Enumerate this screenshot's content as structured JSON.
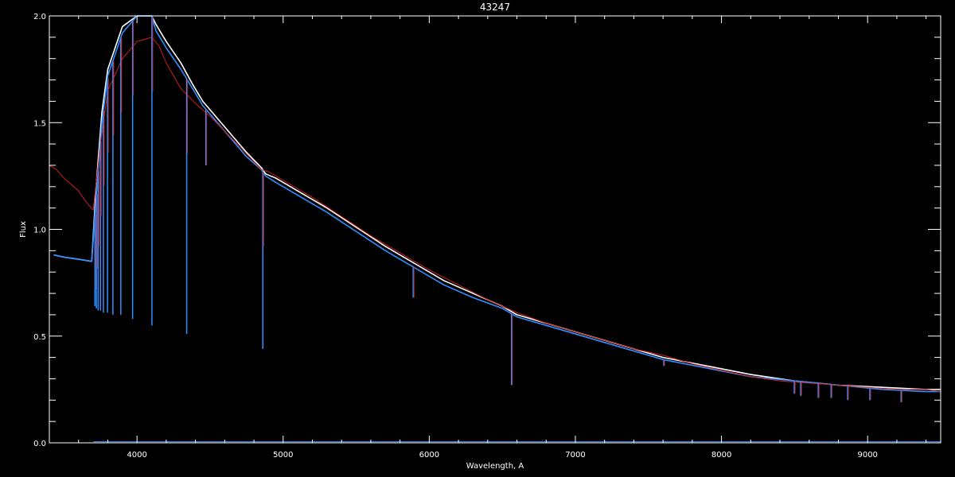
{
  "chart_data": {
    "type": "line",
    "title": "43247",
    "xlabel": "Wavelength, A",
    "ylabel": "Flux",
    "xlim": [
      3400,
      9500
    ],
    "ylim": [
      0.0,
      2.0
    ],
    "xticks": [
      4000,
      5000,
      6000,
      7000,
      8000,
      9000
    ],
    "xtick_labels": [
      "4000",
      "5000",
      "6000",
      "7000",
      "8000",
      "9000"
    ],
    "yticks": [
      0.0,
      0.5,
      1.0,
      1.5,
      2.0
    ],
    "ytick_labels": [
      "0.0",
      "0.5",
      "1.0",
      "1.5",
      "2.0"
    ],
    "background": "#000000",
    "axis_color": "#ffffff",
    "grid": false,
    "series": [
      {
        "color": "#ffffff",
        "x": [
          3430,
          3500,
          3600,
          3690,
          3720,
          3760,
          3800,
          3900,
          4000,
          4100,
          4130,
          4200,
          4300,
          4380,
          4450,
          4550,
          4650,
          4750,
          4850,
          4880,
          4950,
          5100,
          5300,
          5500,
          5700,
          5900,
          6100,
          6300,
          6500,
          6600,
          6800,
          7000,
          7300,
          7600,
          7900,
          8200,
          8500,
          8800,
          9100,
          9400,
          9500
        ],
        "y": [
          0.88,
          0.87,
          0.86,
          0.85,
          1.2,
          1.55,
          1.75,
          1.95,
          2.0,
          2.0,
          1.96,
          1.88,
          1.78,
          1.68,
          1.6,
          1.52,
          1.44,
          1.36,
          1.29,
          1.26,
          1.24,
          1.18,
          1.1,
          1.01,
          0.92,
          0.84,
          0.76,
          0.7,
          0.64,
          0.6,
          0.56,
          0.52,
          0.46,
          0.4,
          0.36,
          0.32,
          0.29,
          0.27,
          0.26,
          0.25,
          0.25
        ]
      },
      {
        "color": "#2f8fff",
        "x": [
          3430,
          3500,
          3600,
          3690,
          3720,
          3760,
          3800,
          3900,
          4000,
          4100,
          4130,
          4200,
          4300,
          4380,
          4450,
          4550,
          4650,
          4750,
          4850,
          4880,
          4950,
          5100,
          5300,
          5500,
          5700,
          5900,
          6100,
          6300,
          6500,
          6600,
          6800,
          7000,
          7300,
          7600,
          7900,
          8200,
          8500,
          8800,
          9100,
          9400,
          9500
        ],
        "y": [
          0.88,
          0.87,
          0.86,
          0.85,
          1.15,
          1.5,
          1.72,
          1.92,
          2.0,
          2.0,
          1.93,
          1.85,
          1.75,
          1.66,
          1.58,
          1.5,
          1.42,
          1.34,
          1.28,
          1.25,
          1.22,
          1.16,
          1.08,
          0.99,
          0.9,
          0.82,
          0.74,
          0.68,
          0.63,
          0.59,
          0.55,
          0.51,
          0.45,
          0.39,
          0.35,
          0.31,
          0.29,
          0.27,
          0.25,
          0.24,
          0.24
        ]
      },
      {
        "color": "#cc1f1f",
        "x": [
          3400,
          3450,
          3500,
          3550,
          3600,
          3650,
          3700,
          3750,
          3800,
          3900,
          4000,
          4100,
          4150,
          4200,
          4250,
          4300,
          4400,
          4500,
          4600,
          4700,
          4850,
          4900,
          5000,
          5200,
          5400,
          5600,
          5800,
          6000,
          6200,
          6400,
          6600,
          6800,
          7000,
          7200,
          7400,
          7600,
          7800,
          8000,
          8200,
          8400,
          8600,
          8800,
          9000,
          9200,
          9400,
          9500
        ],
        "y": [
          1.3,
          1.28,
          1.24,
          1.21,
          1.18,
          1.13,
          1.09,
          1.4,
          1.65,
          1.8,
          1.88,
          1.9,
          1.86,
          1.78,
          1.72,
          1.66,
          1.59,
          1.53,
          1.46,
          1.39,
          1.28,
          1.27,
          1.23,
          1.15,
          1.06,
          0.97,
          0.89,
          0.81,
          0.74,
          0.67,
          0.61,
          0.56,
          0.52,
          0.48,
          0.44,
          0.41,
          0.37,
          0.34,
          0.31,
          0.29,
          0.28,
          0.27,
          0.26,
          0.25,
          0.25,
          0.24
        ]
      }
    ],
    "absorption_lines": [
      {
        "x": 3712,
        "depth_to": 0.64
      },
      {
        "x": 3722,
        "depth_to": 0.63
      },
      {
        "x": 3734,
        "depth_to": 0.62
      },
      {
        "x": 3750,
        "depth_to": 0.62
      },
      {
        "x": 3770,
        "depth_to": 0.61
      },
      {
        "x": 3798,
        "depth_to": 0.61
      },
      {
        "x": 3835,
        "depth_to": 0.6
      },
      {
        "x": 3889,
        "depth_to": 0.6
      },
      {
        "x": 3970,
        "depth_to": 0.58
      },
      {
        "x": 4102,
        "depth_to": 0.55
      },
      {
        "x": 4340,
        "depth_to": 0.51
      },
      {
        "x": 4471,
        "depth_to": 1.3
      },
      {
        "x": 4861,
        "depth_to": 0.44
      },
      {
        "x": 5890,
        "depth_to": 0.68
      },
      {
        "x": 6563,
        "depth_to": 0.27
      },
      {
        "x": 7605,
        "depth_to": 0.36
      },
      {
        "x": 8498,
        "depth_to": 0.23
      },
      {
        "x": 8542,
        "depth_to": 0.22
      },
      {
        "x": 8662,
        "depth_to": 0.21
      },
      {
        "x": 8750,
        "depth_to": 0.21
      },
      {
        "x": 8863,
        "depth_to": 0.2
      },
      {
        "x": 9015,
        "depth_to": 0.2
      },
      {
        "x": 9229,
        "depth_to": 0.19
      }
    ],
    "error_series": {
      "color": "#2f8fff",
      "x": [
        3700,
        9500
      ],
      "y": [
        0.005,
        0.005
      ]
    }
  }
}
